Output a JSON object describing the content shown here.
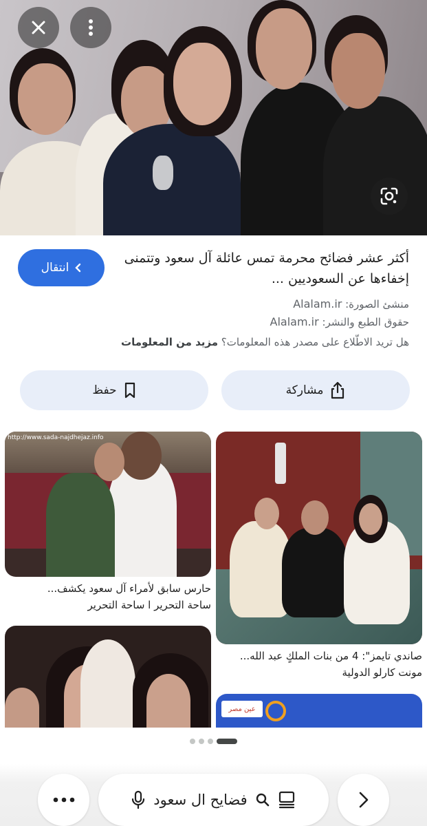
{
  "viewer": {
    "close_icon": "close-icon",
    "more_icon": "more-vertical-icon",
    "lens_icon": "google-lens-icon"
  },
  "result": {
    "visit_label": "انتقال",
    "title": "أكثر عشر فضائح محرمة تمس عائلة آل سعود وتتمنى إخفاءها عن السعوديين ...",
    "creator_label": "منشئ الصورة:",
    "creator_value": "Alalam.ir",
    "copyright_label": "حقوق الطبع والنشر:",
    "copyright_value": "Alalam.ir",
    "more_question": "هل تريد الاطّلاع على مصدر هذه المعلومات؟",
    "more_link": "مزيد من المعلومات",
    "share_label": "مشاركة",
    "save_label": "حفظ"
  },
  "related": [
    {
      "watermark": "http://www.sada-najdhejaz.info",
      "title": "حارس سابق لأمراء آل سعود يكشف...",
      "source": "ساحة التحرير ا ساحة التحرير"
    },
    {
      "title": "صاندي تايمز\": 4 من بنات الملكٍ عبد الله...",
      "source": "مونت كارلو الدولية"
    },
    {
      "watermark": "عين مصر"
    }
  ],
  "pager": {
    "count": 4,
    "active_index": 3
  },
  "bottom_bar": {
    "search_query": "فضايح ال سعود",
    "menu_icon": "more-horizontal-icon",
    "mic_icon": "mic-icon",
    "search_icon": "search-icon",
    "tabs_icon": "tabs-icon",
    "forward_icon": "chevron-right-icon"
  },
  "colors": {
    "accent": "#2f6fe0",
    "pill_bg": "#e8eef9"
  }
}
